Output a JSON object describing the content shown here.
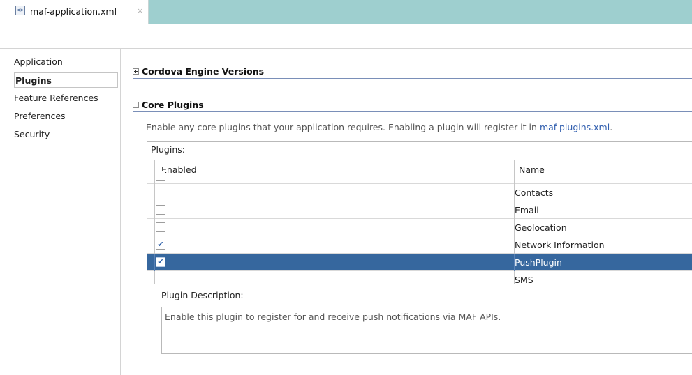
{
  "editor": {
    "tab_title": "maf-application.xml",
    "tab_close": "×"
  },
  "navigator": {
    "items": [
      {
        "label": "Application"
      },
      {
        "label": "Plugins",
        "selected": true
      },
      {
        "label": "Feature References"
      },
      {
        "label": "Preferences"
      },
      {
        "label": "Security"
      }
    ]
  },
  "sections": {
    "cordova": {
      "title": "Cordova Engine Versions",
      "expanded": false
    },
    "core": {
      "title": "Core Plugins",
      "expanded": true
    }
  },
  "core_plugins": {
    "description_prefix": "Enable any core plugins that your application requires. Enabling a plugin will register it in ",
    "description_link": "maf-plugins.xml",
    "description_suffix": "."
  },
  "plugins_table": {
    "caption": "Plugins:",
    "columns": {
      "enabled": "Enabled",
      "name": "Name"
    },
    "rows": [
      {
        "name": "",
        "checked": false,
        "selected": false
      },
      {
        "name": "Contacts",
        "checked": false,
        "selected": false
      },
      {
        "name": "Email",
        "checked": false,
        "selected": false
      },
      {
        "name": "Geolocation",
        "checked": false,
        "selected": false
      },
      {
        "name": "Network Information",
        "checked": true,
        "selected": false
      },
      {
        "name": "PushPlugin",
        "checked": true,
        "selected": true
      },
      {
        "name": "SMS",
        "checked": false,
        "selected": false
      }
    ]
  },
  "plugin_description": {
    "label": "Plugin Description:",
    "text": "Enable this plugin to register for and receive push notifications via MAF APIs."
  },
  "icons": {
    "file": "xml-file-icon",
    "collapse": "collapse-icon",
    "expand": "expand-icon",
    "check": "✔"
  },
  "colors": {
    "tab_strip": "#9ecfcf",
    "selection": "#36679e",
    "link": "#2f5dae",
    "section_rule": "#7a8fb8"
  }
}
